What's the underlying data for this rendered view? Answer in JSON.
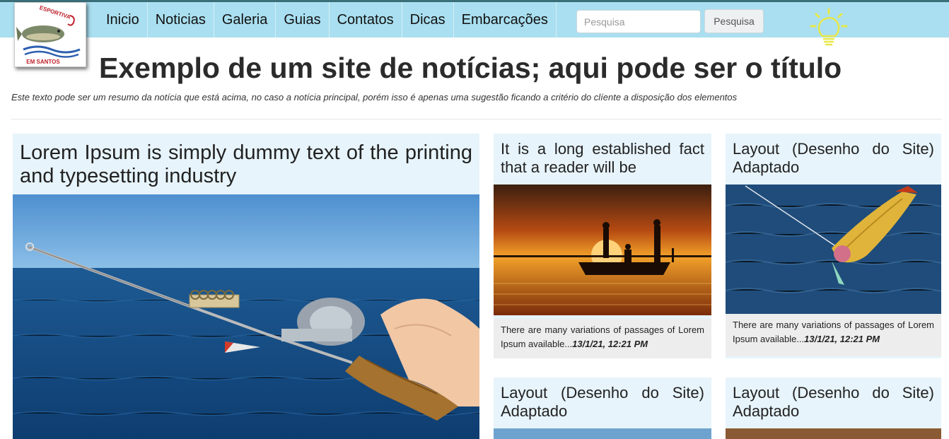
{
  "nav": {
    "items": [
      "Inicio",
      "Noticias",
      "Galeria",
      "Guias",
      "Contatos",
      "Dicas",
      "Embarcações"
    ]
  },
  "search": {
    "placeholder": "Pesquisa",
    "button_label": "Pesquisa"
  },
  "logo": {
    "text_top": "ESPORTIVA",
    "text_bottom": "EM SANTOS"
  },
  "headline": "Exemplo de um site de notícias; aqui pode ser o título",
  "summary": "Este texto pode ser um resumo da notícia que está acima, no caso a notícia principal, porém isso é apenas uma sugestão ficando a critério do clíente a disposição dos elementos",
  "main_card": {
    "title": "Lorem Ipsum is simply dummy text of the printing and typesetting industry"
  },
  "cards": [
    {
      "title": "It is a long established fact that a reader will be",
      "body": "There are many variations of passages of Lorem Ipsum available...",
      "timestamp": "13/1/21, 12:21 PM"
    },
    {
      "title": "Layout (Desenho do Site) Adaptado",
      "body": "There are many variations of passages of Lorem Ipsum available...",
      "timestamp": "13/1/21, 12:21 PM"
    },
    {
      "title": "Layout (Desenho do Site) Adaptado"
    },
    {
      "title": "Layout (Desenho do Site) Adaptado"
    }
  ],
  "colors": {
    "navbar": "#a9dff0",
    "card_bg": "#e7f4fb",
    "bulb": "#e8e84a"
  }
}
